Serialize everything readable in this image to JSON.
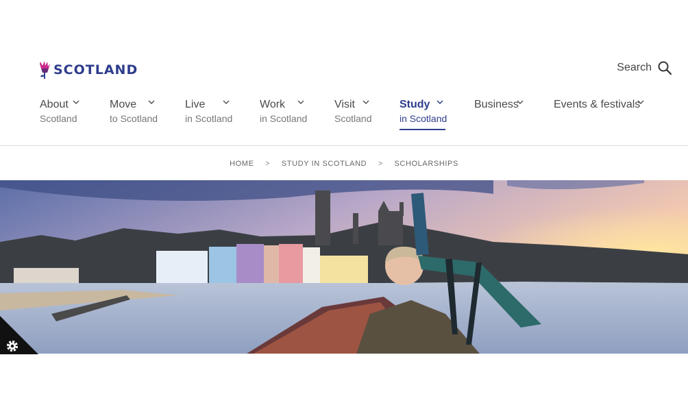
{
  "brand": {
    "logo_text": "SCOTLAND"
  },
  "search": {
    "label": "Search"
  },
  "nav": {
    "items": [
      {
        "main": "About",
        "sub": "Scotland"
      },
      {
        "main": "Move",
        "sub": "to Scotland"
      },
      {
        "main": "Live",
        "sub": "in Scotland"
      },
      {
        "main": "Work",
        "sub": "in Scotland"
      },
      {
        "main": "Visit",
        "sub": "Scotland"
      },
      {
        "main": "Study",
        "sub": "in Scotland"
      },
      {
        "main": "Business",
        "sub": ""
      },
      {
        "main": "Events & festivals",
        "sub": ""
      }
    ],
    "active_item": "Study"
  },
  "breadcrumb": {
    "items": [
      "HOME",
      "STUDY IN SCOTLAND",
      "SCHOLARSHIPS"
    ],
    "separator": ">"
  },
  "colors": {
    "brand_blue": "#2d3c8c",
    "thistle_magenta": "#c8288c"
  },
  "icons": {
    "search": "search-icon",
    "cookie": "gear-icon",
    "chevron": "chevron-down-icon",
    "logo": "thistle-icon"
  }
}
